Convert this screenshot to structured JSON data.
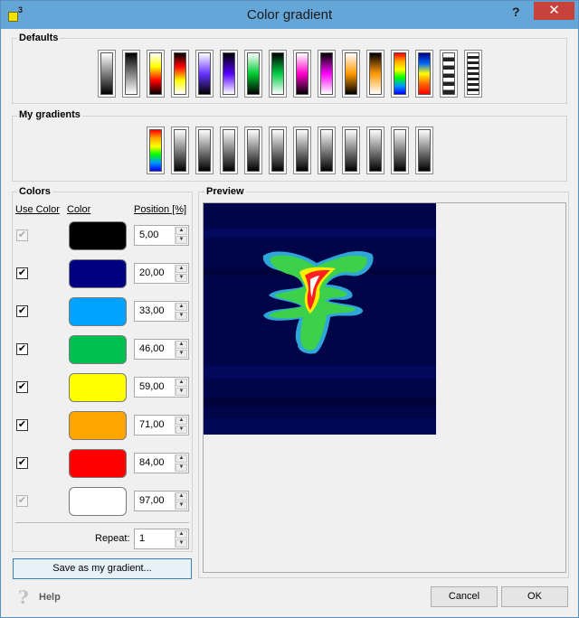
{
  "window": {
    "title": "Color gradient",
    "help_glyph": "?",
    "close_glyph": "✕"
  },
  "defaults": {
    "label": "Defaults",
    "gradients": [
      {
        "name": "black-to-white",
        "stops": [
          "#ffffff",
          "#000000"
        ]
      },
      {
        "name": "white-to-black",
        "stops": [
          "#000000",
          "#ffffff"
        ]
      },
      {
        "name": "hot",
        "stops": [
          "#ffffff",
          "#ffff00",
          "#ff0000",
          "#000000"
        ]
      },
      {
        "name": "red-yellow",
        "stops": [
          "#000000",
          "#ff0000",
          "#ffff00",
          "#ffffff"
        ]
      },
      {
        "name": "blue-white",
        "stops": [
          "#ffffff",
          "#6633ff",
          "#000000"
        ]
      },
      {
        "name": "purple",
        "stops": [
          "#000000",
          "#5500ff",
          "#ffffff"
        ]
      },
      {
        "name": "green-white",
        "stops": [
          "#ffffff",
          "#00cc33",
          "#000000"
        ]
      },
      {
        "name": "green",
        "stops": [
          "#000000",
          "#00cc44",
          "#ffffff"
        ]
      },
      {
        "name": "magenta-white",
        "stops": [
          "#ffffff",
          "#ff00cc",
          "#000000"
        ]
      },
      {
        "name": "magenta",
        "stops": [
          "#000000",
          "#ff00ff",
          "#ffffff"
        ]
      },
      {
        "name": "orange-white",
        "stops": [
          "#ffffff",
          "#ff9900",
          "#000000"
        ]
      },
      {
        "name": "orange",
        "stops": [
          "#000000",
          "#ff9900",
          "#ffffff"
        ]
      },
      {
        "name": "rainbow",
        "stops": [
          "#ff0000",
          "#ffaa00",
          "#ffff00",
          "#00ff00",
          "#0099ff",
          "#0000ff"
        ]
      },
      {
        "name": "jet",
        "stops": [
          "#000088",
          "#0066ff",
          "#ffff00",
          "#ff6600",
          "#ff0000"
        ]
      },
      {
        "name": "stripes-1",
        "stops": [
          "striped"
        ]
      },
      {
        "name": "stripes-2",
        "stops": [
          "striped-dense"
        ]
      }
    ]
  },
  "my_gradients": {
    "label": "My gradients",
    "gradients": [
      {
        "name": "my-rainbow",
        "stops": [
          "#ff0000",
          "#ffaa00",
          "#ffff00",
          "#00ff00",
          "#0099ff",
          "#0000ff"
        ]
      },
      {
        "name": "slot-1",
        "stops": [
          "#ffffff",
          "#000000"
        ]
      },
      {
        "name": "slot-2",
        "stops": [
          "#ffffff",
          "#000000"
        ]
      },
      {
        "name": "slot-3",
        "stops": [
          "#ffffff",
          "#000000"
        ]
      },
      {
        "name": "slot-4",
        "stops": [
          "#ffffff",
          "#000000"
        ]
      },
      {
        "name": "slot-5",
        "stops": [
          "#ffffff",
          "#000000"
        ]
      },
      {
        "name": "slot-6",
        "stops": [
          "#ffffff",
          "#000000"
        ]
      },
      {
        "name": "slot-7",
        "stops": [
          "#ffffff",
          "#000000"
        ]
      },
      {
        "name": "slot-8",
        "stops": [
          "#ffffff",
          "#000000"
        ]
      },
      {
        "name": "slot-9",
        "stops": [
          "#ffffff",
          "#000000"
        ]
      },
      {
        "name": "slot-10",
        "stops": [
          "#ffffff",
          "#000000"
        ]
      },
      {
        "name": "slot-11",
        "stops": [
          "#ffffff",
          "#000000"
        ]
      }
    ]
  },
  "colors": {
    "label": "Colors",
    "col_use": "Use Color",
    "col_color": "Color",
    "col_position": "Position [%]",
    "rows": [
      {
        "checked": true,
        "enabled": false,
        "color": "#000000",
        "position": "5,00"
      },
      {
        "checked": true,
        "enabled": true,
        "color": "#000080",
        "position": "20,00"
      },
      {
        "checked": true,
        "enabled": true,
        "color": "#00a2ff",
        "position": "33,00"
      },
      {
        "checked": true,
        "enabled": true,
        "color": "#00c050",
        "position": "46,00"
      },
      {
        "checked": true,
        "enabled": true,
        "color": "#ffff00",
        "position": "59,00"
      },
      {
        "checked": true,
        "enabled": true,
        "color": "#ffa500",
        "position": "71,00"
      },
      {
        "checked": true,
        "enabled": true,
        "color": "#ff0000",
        "position": "84,00"
      },
      {
        "checked": true,
        "enabled": false,
        "color": "#ffffff",
        "position": "97,00"
      }
    ],
    "repeat_label": "Repeat:",
    "repeat_value": "1"
  },
  "save_button": "Save as my gradient...",
  "preview": {
    "label": "Preview"
  },
  "footer": {
    "help_label": "Help",
    "help_glyph": "?",
    "cancel": "Cancel",
    "ok": "OK"
  }
}
